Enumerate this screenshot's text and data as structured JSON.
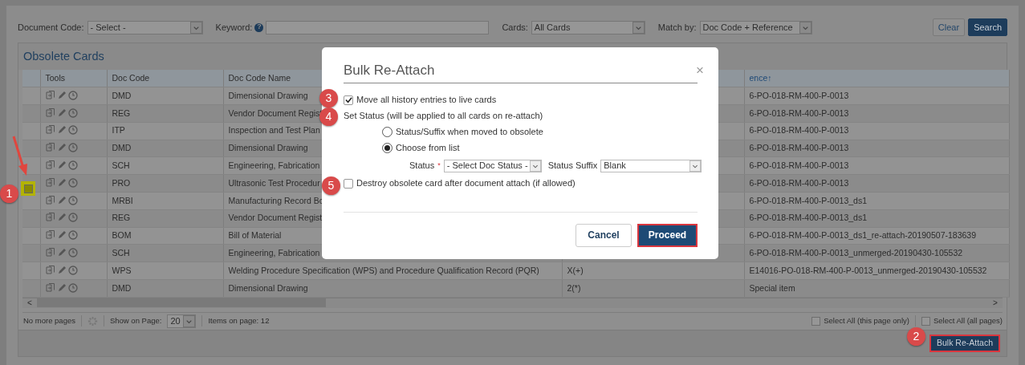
{
  "filters": {
    "document_code": {
      "label": "Document Code:",
      "value": "- Select -"
    },
    "keyword": {
      "label": "Keyword:",
      "help": "?"
    },
    "cards": {
      "label": "Cards:",
      "value": "All Cards"
    },
    "match_by": {
      "label": "Match by:",
      "value": "Doc Code + Reference"
    },
    "buttons": {
      "clear": "Clear",
      "search": "Search"
    }
  },
  "panel": {
    "title": "Obsolete Cards"
  },
  "table": {
    "columns": {
      "tools": "Tools",
      "doc_code": "Doc Code",
      "doc_code_name": "Doc Code Name",
      "reference": "ence↑"
    },
    "rows": [
      {
        "doc_code": "DMD",
        "doc_code_name": "Dimensional Drawing",
        "reference": "6-PO-018-RM-400-P-0013"
      },
      {
        "doc_code": "REG",
        "doc_code_name": "Vendor Document Regist",
        "reference": "6-PO-018-RM-400-P-0013"
      },
      {
        "doc_code": "ITP",
        "doc_code_name": "Inspection and Test Plan",
        "reference": "6-PO-018-RM-400-P-0013"
      },
      {
        "doc_code": "DMD",
        "doc_code_name": "Dimensional Drawing",
        "reference": "6-PO-018-RM-400-P-0013"
      },
      {
        "doc_code": "SCH",
        "doc_code_name": "Engineering, Fabrication",
        "reference": "6-PO-018-RM-400-P-0013"
      },
      {
        "checkbox": {
          "checked": false,
          "highlighted": true
        },
        "doc_code": "PRO",
        "doc_code_name": "Ultrasonic Test Procedur",
        "reference": "6-PO-018-RM-400-P-0013"
      },
      {
        "doc_code": "MRBI",
        "doc_code_name": "Manufacturing Record Bo",
        "reference": "6-PO-018-RM-400-P-0013_ds1"
      },
      {
        "doc_code": "REG",
        "doc_code_name": "Vendor Document Regist",
        "reference": "6-PO-018-RM-400-P-0013_ds1"
      },
      {
        "doc_code": "BOM",
        "doc_code_name": "Bill of Material",
        "reference": "6-PO-018-RM-400-P-0013_ds1_re-attach-20190507-183639"
      },
      {
        "doc_code": "SCH",
        "doc_code_name": "Engineering, Fabrication",
        "reference": "6-PO-018-RM-400-P-0013_unmerged-20190430-105532"
      },
      {
        "doc_code": "WPS",
        "doc_code_name": "Welding Procedure Specification (WPS) and Procedure Qualification Record (PQR)",
        "column_5": "X(+)",
        "reference": "E14016-PO-018-RM-400-P-0013_unmerged-20190430-105532"
      },
      {
        "doc_code": "DMD",
        "doc_code_name": "Dimensional Drawing",
        "column_5": "2(*)",
        "reference": "Special item"
      }
    ]
  },
  "scrollbar": {
    "left": "<",
    "right": ">"
  },
  "footer": {
    "paging": "No more pages",
    "show_label": "Show on Page:",
    "page_size": "20",
    "items": "Items on page: 12",
    "select_all_page": {
      "label": "Select All (this page only)",
      "checked": false
    },
    "select_all_pages": {
      "label": "Select All (all pages)",
      "checked": false
    }
  },
  "bulk_button": "Bulk Re-Attach",
  "modal": {
    "title": "Bulk Re-Attach",
    "close": "×",
    "move_history": {
      "label": "Move all history entries to live cards",
      "checked": true
    },
    "set_status": "Set Status (will be applied to all cards on re-attach)",
    "radios": [
      {
        "label": "Status/Suffix when moved to obsolete",
        "selected": false
      },
      {
        "label": "Choose from list",
        "selected": true
      }
    ],
    "status": {
      "label": "Status",
      "required": "*",
      "value": "- Select Doc Status -"
    },
    "suffix": {
      "label": "Status Suffix",
      "value": "Blank"
    },
    "destroy": {
      "label": "Destroy obsolete card after document attach (if allowed)",
      "checked": false
    },
    "cancel": "Cancel",
    "proceed": "Proceed"
  },
  "annotations": [
    {
      "label": "1"
    },
    {
      "label": "2"
    },
    {
      "label": "3"
    },
    {
      "label": "4"
    },
    {
      "label": "5"
    }
  ]
}
